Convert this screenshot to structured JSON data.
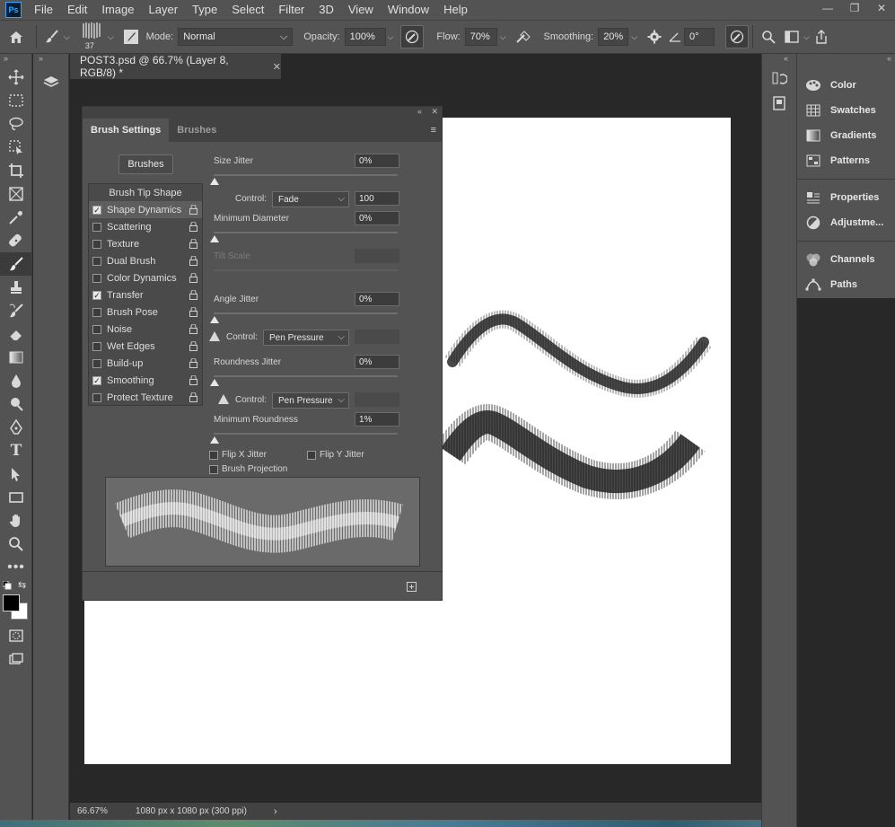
{
  "app": {
    "logo": "Ps"
  },
  "menu": [
    "File",
    "Edit",
    "Image",
    "Layer",
    "Type",
    "Select",
    "Filter",
    "3D",
    "View",
    "Window",
    "Help"
  ],
  "options": {
    "brush_size": "37",
    "mode_label": "Mode:",
    "mode_value": "Normal",
    "opacity_label": "Opacity:",
    "opacity_value": "100%",
    "flow_label": "Flow:",
    "flow_value": "70%",
    "smoothing_label": "Smoothing:",
    "smoothing_value": "20%",
    "angle_value": "0°"
  },
  "document": {
    "tab_title": "POST3.psd @ 66.7% (Layer 8, RGB/8) *",
    "zoom": "66.67%",
    "dimensions": "1080 px x 1080 px (300 ppi)"
  },
  "right_panels": {
    "group1": [
      {
        "label": "Color",
        "icon": "color-palette-icon"
      },
      {
        "label": "Swatches",
        "icon": "swatches-grid-icon"
      },
      {
        "label": "Gradients",
        "icon": "gradient-icon"
      },
      {
        "label": "Patterns",
        "icon": "patterns-icon"
      }
    ],
    "group2": [
      {
        "label": "Properties",
        "icon": "properties-icon"
      },
      {
        "label": "Adjustme...",
        "icon": "adjustments-icon"
      }
    ],
    "group3": [
      {
        "label": "Channels",
        "icon": "channels-icon"
      },
      {
        "label": "Paths",
        "icon": "paths-icon"
      }
    ]
  },
  "brush_panel": {
    "tabs": [
      "Brush Settings",
      "Brushes"
    ],
    "brushes_button": "Brushes",
    "list": [
      {
        "label": "Brush Tip Shape",
        "checkbox": false,
        "checked": false,
        "lock": false
      },
      {
        "label": "Shape Dynamics",
        "checkbox": true,
        "checked": true,
        "lock": true
      },
      {
        "label": "Scattering",
        "checkbox": true,
        "checked": false,
        "lock": true
      },
      {
        "label": "Texture",
        "checkbox": true,
        "checked": false,
        "lock": true
      },
      {
        "label": "Dual Brush",
        "checkbox": true,
        "checked": false,
        "lock": true
      },
      {
        "label": "Color Dynamics",
        "checkbox": true,
        "checked": false,
        "lock": true
      },
      {
        "label": "Transfer",
        "checkbox": true,
        "checked": true,
        "lock": true
      },
      {
        "label": "Brush Pose",
        "checkbox": true,
        "checked": false,
        "lock": true
      },
      {
        "label": "Noise",
        "checkbox": true,
        "checked": false,
        "lock": true
      },
      {
        "label": "Wet Edges",
        "checkbox": true,
        "checked": false,
        "lock": true
      },
      {
        "label": "Build-up",
        "checkbox": true,
        "checked": false,
        "lock": true
      },
      {
        "label": "Smoothing",
        "checkbox": true,
        "checked": true,
        "lock": true
      },
      {
        "label": "Protect Texture",
        "checkbox": true,
        "checked": false,
        "lock": true
      }
    ],
    "size_jitter_label": "Size Jitter",
    "size_jitter_value": "0%",
    "control_label": "Control:",
    "control1_value": "Fade",
    "control1_number": "100",
    "min_diameter_label": "Minimum Diameter",
    "min_diameter_value": "0%",
    "tilt_scale_label": "Tilt Scale",
    "angle_jitter_label": "Angle Jitter",
    "angle_jitter_value": "0%",
    "control2_value": "Pen Pressure",
    "roundness_jitter_label": "Roundness Jitter",
    "roundness_jitter_value": "0%",
    "control3_value": "Pen Pressure",
    "min_roundness_label": "Minimum Roundness",
    "min_roundness_value": "1%",
    "flip_x_label": "Flip X Jitter",
    "flip_y_label": "Flip Y Jitter",
    "projection_label": "Brush Projection"
  }
}
